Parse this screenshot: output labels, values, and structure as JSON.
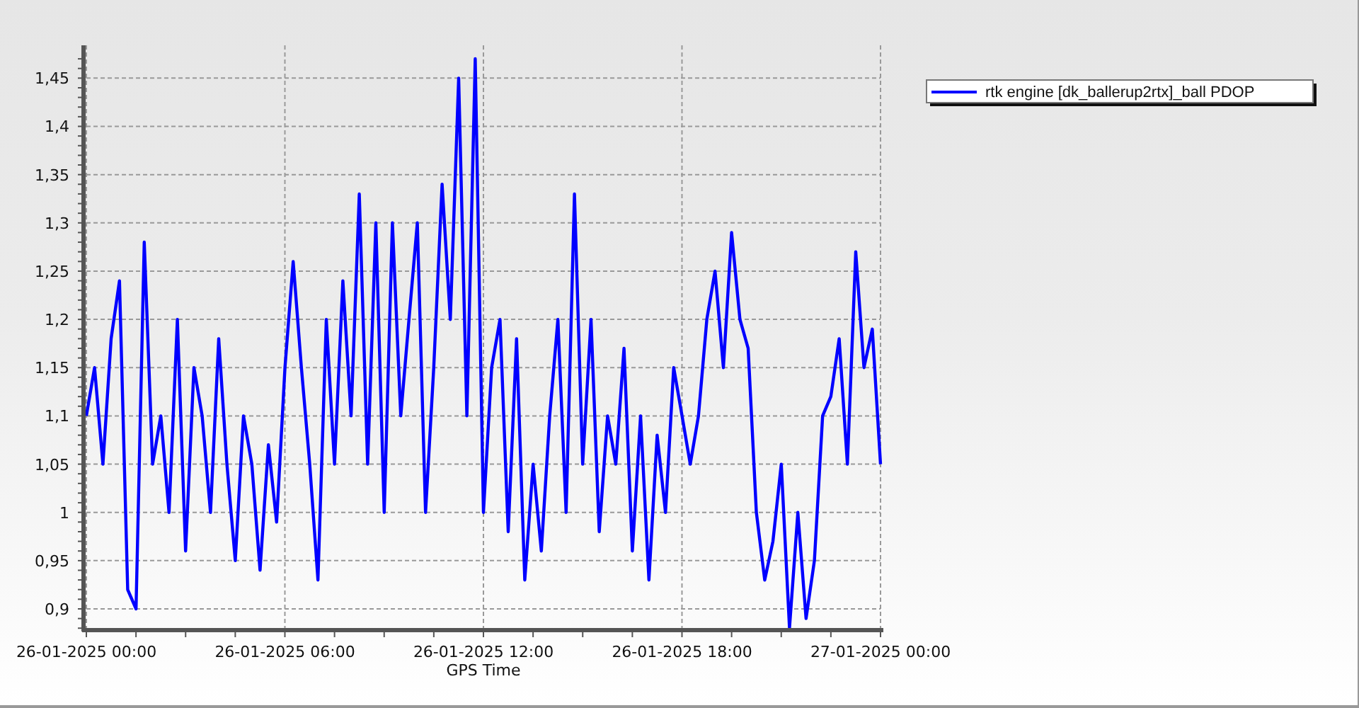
{
  "chart_data": {
    "type": "line",
    "grid": true,
    "xlabel": "GPS Time",
    "categories": [
      "26-01-2025 00:00",
      null,
      null,
      null,
      null,
      null,
      null,
      null,
      null,
      null,
      null,
      null,
      null,
      null,
      null,
      null,
      null,
      null,
      null,
      null,
      null,
      null,
      null,
      null,
      "26-01-2025 06:00",
      null,
      null,
      null,
      null,
      null,
      null,
      null,
      null,
      null,
      null,
      null,
      null,
      null,
      null,
      null,
      null,
      null,
      null,
      null,
      null,
      null,
      null,
      null,
      "26-01-2025 12:00",
      null,
      null,
      null,
      null,
      null,
      null,
      null,
      null,
      null,
      null,
      null,
      null,
      null,
      null,
      null,
      null,
      null,
      null,
      null,
      null,
      null,
      null,
      null,
      "26-01-2025 18:00",
      null,
      null,
      null,
      null,
      null,
      null,
      null,
      null,
      null,
      null,
      null,
      null,
      null,
      null,
      null,
      null,
      null,
      null,
      null,
      null,
      null,
      null,
      null,
      "27-01-2025 00:00"
    ],
    "series": [
      {
        "name": "rtk engine [dk_ballerup2rtx]_ball PDOP",
        "color": "#0000ff",
        "values": [
          1.1,
          1.15,
          1.05,
          1.18,
          1.24,
          0.92,
          0.9,
          1.28,
          1.05,
          1.1,
          1.0,
          1.2,
          0.96,
          1.15,
          1.1,
          1.0,
          1.18,
          1.05,
          0.95,
          1.1,
          1.05,
          0.94,
          1.07,
          0.99,
          1.15,
          1.26,
          1.15,
          1.05,
          0.93,
          1.2,
          1.05,
          1.24,
          1.1,
          1.33,
          1.05,
          1.3,
          1.0,
          1.3,
          1.1,
          1.2,
          1.3,
          1.0,
          1.15,
          1.34,
          1.2,
          1.45,
          1.1,
          1.47,
          1.0,
          1.15,
          1.2,
          0.98,
          1.18,
          0.93,
          1.05,
          0.96,
          1.1,
          1.2,
          1.0,
          1.33,
          1.05,
          1.2,
          0.98,
          1.1,
          1.05,
          1.17,
          0.96,
          1.1,
          0.93,
          1.08,
          1.0,
          1.15,
          1.1,
          1.05,
          1.1,
          1.2,
          1.25,
          1.15,
          1.29,
          1.2,
          1.17,
          1.0,
          0.93,
          0.97,
          1.05,
          0.88,
          1.0,
          0.89,
          0.95,
          1.1,
          1.12,
          1.18,
          1.05,
          1.27,
          1.15,
          1.19,
          1.05
        ]
      }
    ],
    "ylim": [
      0.878,
      1.484
    ],
    "yticks": [
      {
        "value": 0.9,
        "label": "0,9"
      },
      {
        "value": 0.95,
        "label": "0,95"
      },
      {
        "value": 1,
        "label": "1"
      },
      {
        "value": 1.05,
        "label": "1,05"
      },
      {
        "value": 1.1,
        "label": "1,1"
      },
      {
        "value": 1.15,
        "label": "1,15"
      },
      {
        "value": 1.2,
        "label": "1,2"
      },
      {
        "value": 1.25,
        "label": "1,25"
      },
      {
        "value": 1.3,
        "label": "1,3"
      },
      {
        "value": 1.35,
        "label": "1,35"
      },
      {
        "value": 1.4,
        "label": "1,4"
      },
      {
        "value": 1.45,
        "label": "1,45"
      }
    ]
  }
}
